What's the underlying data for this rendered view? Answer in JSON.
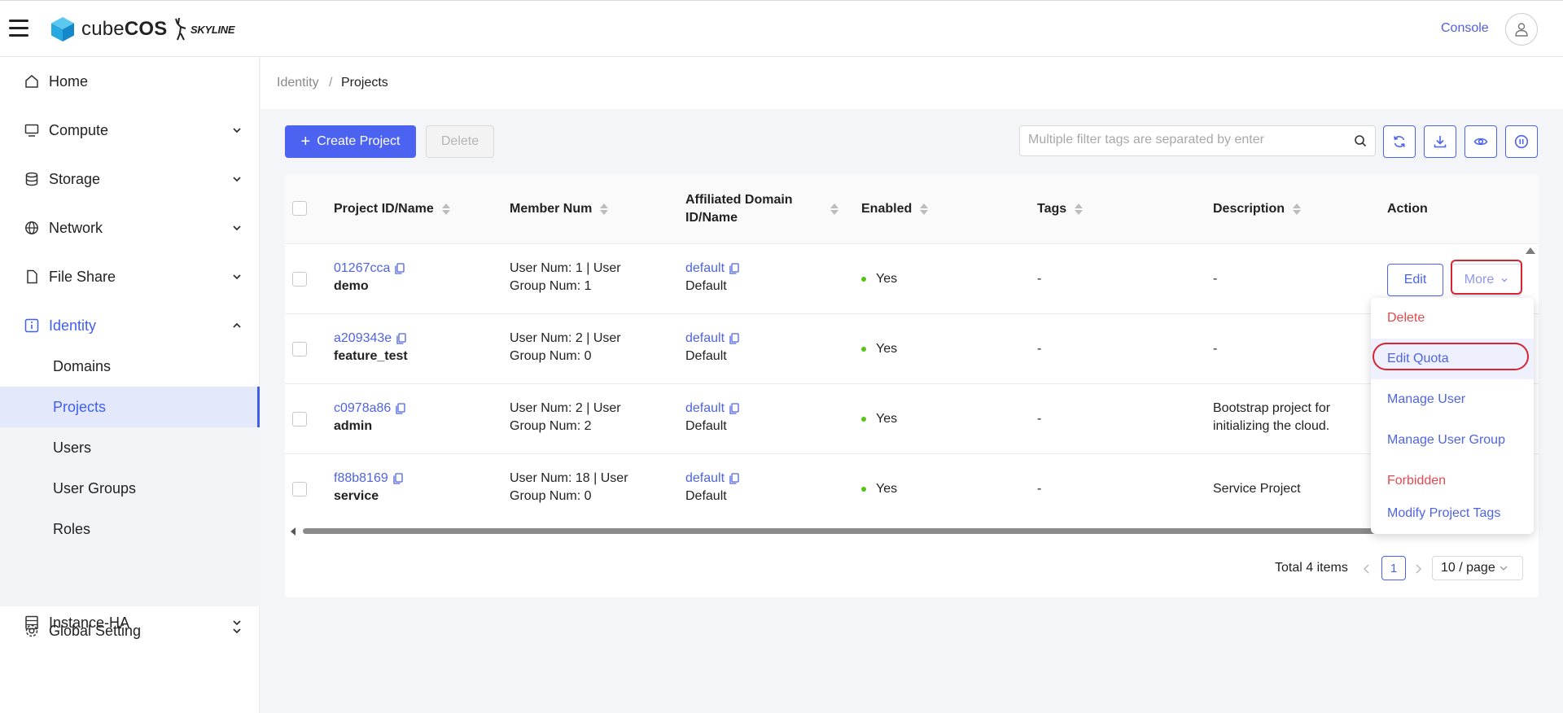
{
  "app": {
    "logo_text_light": "cube",
    "logo_text_bold": "COS",
    "partner_logo": "SKYLINE"
  },
  "header": {
    "console_label": "Console"
  },
  "sidebar": {
    "items": [
      {
        "label": "Home",
        "icon": "home-icon"
      },
      {
        "label": "Compute",
        "icon": "monitor-icon"
      },
      {
        "label": "Storage",
        "icon": "database-icon"
      },
      {
        "label": "Network",
        "icon": "globe-icon"
      },
      {
        "label": "File Share",
        "icon": "file-icon"
      },
      {
        "label": "Identity",
        "icon": "info-icon"
      },
      {
        "label": "Global Setting",
        "icon": "gear-icon"
      },
      {
        "label": "Instance-HA",
        "icon": "server-icon"
      }
    ],
    "identity_sub": [
      "Domains",
      "Projects",
      "Users",
      "User Groups",
      "Roles"
    ]
  },
  "breadcrumb": {
    "parent": "Identity",
    "separator": "/",
    "current": "Projects"
  },
  "toolbar": {
    "create_label": "Create Project",
    "delete_label": "Delete",
    "search_placeholder": "Multiple filter tags are separated by enter"
  },
  "table": {
    "headers": {
      "id_name": "Project ID/Name",
      "members": "Member Num",
      "domain_line1": "Affiliated Domain",
      "domain_line2": "ID/Name",
      "enabled": "Enabled",
      "tags": "Tags",
      "description": "Description",
      "action": "Action"
    },
    "rows": [
      {
        "id": "01267cca",
        "name": "demo",
        "members_line1": "User Num: 1 | User",
        "members_line2": "Group Num: 1",
        "domain_id": "default",
        "domain_name": "Default",
        "enabled": "Yes",
        "tags": "-",
        "description_line1": "-",
        "description_line2": ""
      },
      {
        "id": "a209343e",
        "name": "feature_test",
        "members_line1": "User Num: 2 | User",
        "members_line2": "Group Num: 0",
        "domain_id": "default",
        "domain_name": "Default",
        "enabled": "Yes",
        "tags": "-",
        "description_line1": "-",
        "description_line2": ""
      },
      {
        "id": "c0978a86",
        "name": "admin",
        "members_line1": "User Num: 2 | User",
        "members_line2": "Group Num: 2",
        "domain_id": "default",
        "domain_name": "Default",
        "enabled": "Yes",
        "tags": "-",
        "description_line1": "Bootstrap project for",
        "description_line2": "initializing the cloud."
      },
      {
        "id": "f88b8169",
        "name": "service",
        "members_line1": "User Num: 18 | User",
        "members_line2": "Group Num: 0",
        "domain_id": "default",
        "domain_name": "Default",
        "enabled": "Yes",
        "tags": "-",
        "description_line1": "Service Project",
        "description_line2": ""
      }
    ],
    "edit_label": "Edit",
    "more_label": "More"
  },
  "dropdown": {
    "items": [
      {
        "label": "Delete",
        "color": "#e5484d"
      },
      {
        "label": "Edit Quota",
        "color": "#4f64e2"
      },
      {
        "label": "Manage User",
        "color": "#4f64e2"
      },
      {
        "label": "Manage User Group",
        "color": "#4f64e2"
      },
      {
        "label": "Forbidden",
        "color": "#e5484d"
      },
      {
        "label": "Modify Project Tags",
        "color": "#4f64e2"
      }
    ]
  },
  "pagination": {
    "total_label": "Total 4 items",
    "current_page": "1",
    "page_size": "10 / page"
  },
  "colors": {
    "accent": "#4b63f0",
    "danger": "#e5484d",
    "success": "#52c41a"
  }
}
